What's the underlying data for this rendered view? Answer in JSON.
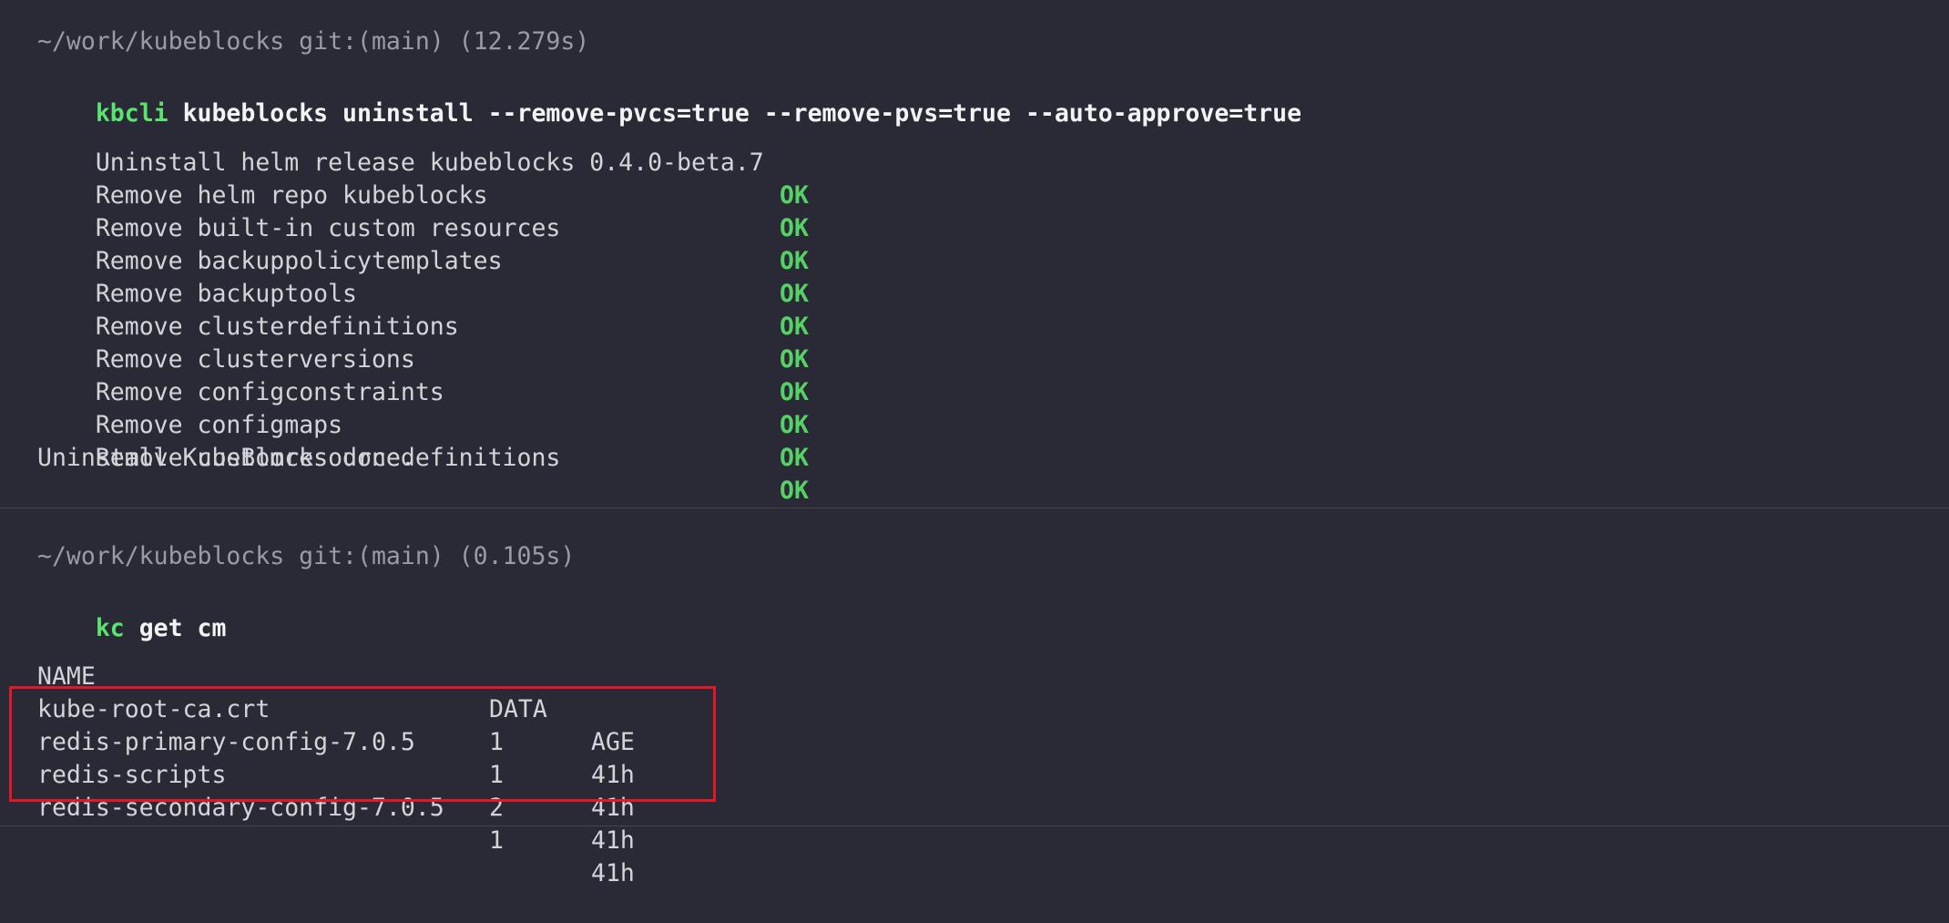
{
  "block1": {
    "prompt": "~/work/kubeblocks git:(main) (12.279s)",
    "command_bin": "kbcli",
    "command_args": " kubeblocks uninstall --remove-pvcs=true --remove-pvs=true --auto-approve=true",
    "steps": [
      {
        "text": "Uninstall helm release kubeblocks 0.4.0-beta.7",
        "status": "OK"
      },
      {
        "text": "Remove helm repo kubeblocks",
        "status": "OK"
      },
      {
        "text": "Remove built-in custom resources",
        "status": "OK"
      },
      {
        "text": "Remove backuppolicytemplates",
        "status": "OK"
      },
      {
        "text": "Remove backuptools",
        "status": "OK"
      },
      {
        "text": "Remove clusterdefinitions",
        "status": "OK"
      },
      {
        "text": "Remove clusterversions",
        "status": "OK"
      },
      {
        "text": "Remove configconstraints",
        "status": "OK"
      },
      {
        "text": "Remove configmaps",
        "status": "OK"
      },
      {
        "text": "Remove customresourcedefinitions",
        "status": "OK"
      }
    ],
    "done": "Uninstall KubeBlocks done."
  },
  "block2": {
    "prompt": "~/work/kubeblocks git:(main) (0.105s)",
    "command_bin": "kc",
    "command_args": " get cm",
    "headers": {
      "name": "NAME",
      "data": "DATA",
      "age": "AGE"
    },
    "rows": [
      {
        "name": "kube-root-ca.crt",
        "data": "1",
        "age": "41h"
      },
      {
        "name": "redis-primary-config-7.0.5",
        "data": "1",
        "age": "41h"
      },
      {
        "name": "redis-scripts",
        "data": "2",
        "age": "41h"
      },
      {
        "name": "redis-secondary-config-7.0.5",
        "data": "1",
        "age": "41h"
      }
    ]
  },
  "colors": {
    "background": "#2a2a36",
    "command_green": "#5be36f",
    "ok_green": "#55d166",
    "highlight_red": "#e0182a"
  }
}
